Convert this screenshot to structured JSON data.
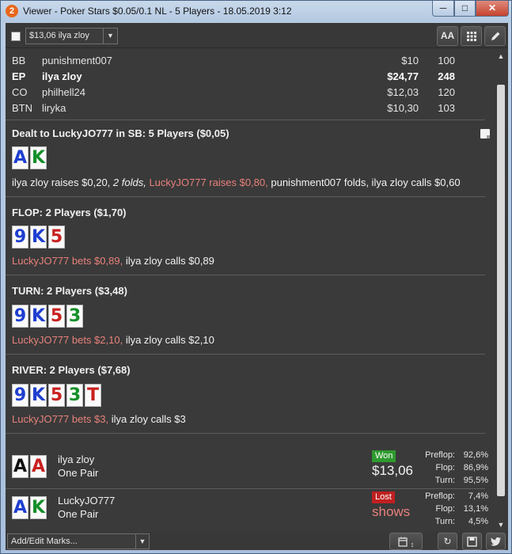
{
  "window": {
    "app_icon": "2",
    "title": "Viewer - Poker Stars $0.05/0.1 NL - 5 Players - 18.05.2019 3:12",
    "min_icon": "minimize-icon",
    "max_icon": "maximize-icon",
    "close_icon": "close-icon"
  },
  "toolbar": {
    "player_selected": "$13,06 ilya zloy",
    "font_button": "AA",
    "grid_icon": "grid-icon",
    "edit_icon": "pencil-icon"
  },
  "seats": [
    {
      "pos": "BB",
      "name": "punishment007",
      "stack": "$10",
      "bb": "100",
      "hero": false
    },
    {
      "pos": "EP",
      "name": "ilya zloy",
      "stack": "$24,77",
      "bb": "248",
      "hero": true
    },
    {
      "pos": "CO",
      "name": "philhell24",
      "stack": "$12,03",
      "bb": "120",
      "hero": false
    },
    {
      "pos": "BTN",
      "name": "liryka",
      "stack": "$10,30",
      "bb": "103",
      "hero": false
    }
  ],
  "preflop": {
    "title": "Dealt to LuckyJO777 in SB: 5 Players ($0,05)",
    "cards": [
      {
        "r": "A",
        "s": "d"
      },
      {
        "r": "K",
        "s": "c"
      }
    ],
    "actions": [
      {
        "t": "ilya zloy raises $0,20, ",
        "style": "n"
      },
      {
        "t": "2 folds, ",
        "style": "i"
      },
      {
        "t": "LuckyJO777 raises $0,80, ",
        "style": "h"
      },
      {
        "t": "punishment007 folds, ilya zloy calls $0,60",
        "style": "n"
      }
    ]
  },
  "flop": {
    "title": "FLOP: 2 Players ($1,70)",
    "cards": [
      {
        "r": "9",
        "s": "d"
      },
      {
        "r": "K",
        "s": "d"
      },
      {
        "r": "5",
        "s": "h"
      }
    ],
    "actions": [
      {
        "t": "LuckyJO777 bets $0,89, ",
        "style": "h"
      },
      {
        "t": "ilya zloy calls $0,89",
        "style": "n"
      }
    ]
  },
  "turn": {
    "title": "TURN: 2 Players ($3,48)",
    "cards": [
      {
        "r": "9",
        "s": "d"
      },
      {
        "r": "K",
        "s": "d"
      },
      {
        "r": "5",
        "s": "h"
      },
      {
        "r": "3",
        "s": "c"
      }
    ],
    "actions": [
      {
        "t": "LuckyJO777 bets $2,10, ",
        "style": "h"
      },
      {
        "t": "ilya zloy calls $2,10",
        "style": "n"
      }
    ]
  },
  "river": {
    "title": "RIVER: 2 Players ($7,68)",
    "cards": [
      {
        "r": "9",
        "s": "d"
      },
      {
        "r": "K",
        "s": "d"
      },
      {
        "r": "5",
        "s": "h"
      },
      {
        "r": "3",
        "s": "c"
      },
      {
        "r": "T",
        "s": "h"
      }
    ],
    "actions": [
      {
        "t": "LuckyJO777 bets $3, ",
        "style": "h"
      },
      {
        "t": "ilya zloy calls $3",
        "style": "n"
      }
    ]
  },
  "results": [
    {
      "name": "ilya zloy",
      "hand": "One Pair",
      "cards": [
        {
          "r": "A",
          "s": "s"
        },
        {
          "r": "A",
          "s": "h"
        }
      ],
      "badge": "Won",
      "badge_type": "won",
      "amount": "$13,06",
      "stats": [
        {
          "l": "Preflop:",
          "v": "92,6%"
        },
        {
          "l": "Flop:",
          "v": "86,9%"
        },
        {
          "l": "Turn:",
          "v": "95,5%"
        }
      ]
    },
    {
      "name": "LuckyJO777",
      "hand": "One Pair",
      "cards": [
        {
          "r": "A",
          "s": "d"
        },
        {
          "r": "K",
          "s": "c"
        }
      ],
      "badge": "Lost",
      "badge_type": "lost",
      "amount": "shows",
      "stats": [
        {
          "l": "Preflop:",
          "v": "7,4%"
        },
        {
          "l": "Flop:",
          "v": "13,1%"
        },
        {
          "l": "Turn:",
          "v": "4,5%"
        }
      ]
    }
  ],
  "bottombar": {
    "marks_label": "Add/Edit Marks...",
    "calendar_icon": "calendar-icon",
    "replay_icon": "replay-icon",
    "save_icon": "save-icon",
    "twitter_icon": "twitter-icon"
  }
}
